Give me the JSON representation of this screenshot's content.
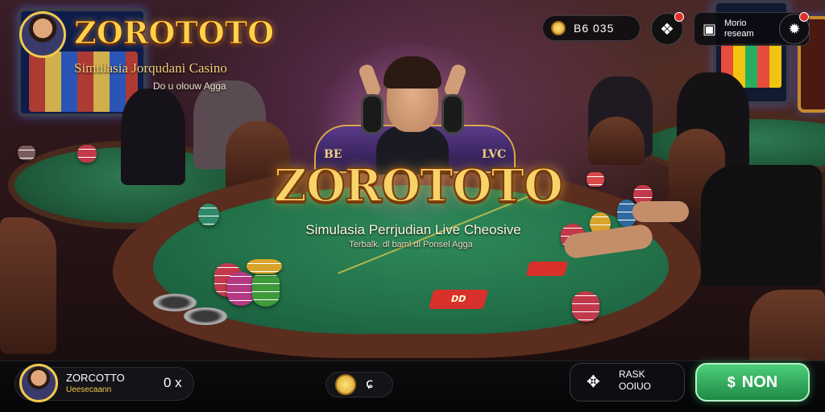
{
  "brand": {
    "title": "ZOROTOTO",
    "subtitle": "Simulasia Jorqudani Casino",
    "tagline": "Do u olouw Agga"
  },
  "hero": {
    "title": "ZOROTOTO",
    "subtitle": "Simulasia Perrjudian Live Cheosive",
    "tagline": "Terbalk. dl baml dl Ponsel Agga",
    "seat_left": "BE",
    "seat_right": "LVC"
  },
  "table": {
    "card_label_1": "DD",
    "card_label_2": ""
  },
  "hud": {
    "balance": "B6 035",
    "promo_label_line1": "Morio",
    "promo_label_line2": "reseam",
    "gift_badge": "",
    "notif_badge": ""
  },
  "bottom": {
    "profile_name": "ZORCOTTO",
    "profile_sub": "Ueesecaann",
    "profile_count": "0 x",
    "mid_icon": "ɕ",
    "rank_label_line1": "RASK",
    "rank_label_line2": "OOIUO",
    "win_label": "NON"
  },
  "icons": {
    "balance": "coin-icon",
    "gift": "gift-icon",
    "promo": "tablet-icon",
    "notif": "bell-icon",
    "rank": "trophy-icon",
    "win": "dollar-icon"
  },
  "colors": {
    "gold": "#f2c94c",
    "felt": "#227048",
    "win_button": "#2fb862"
  }
}
